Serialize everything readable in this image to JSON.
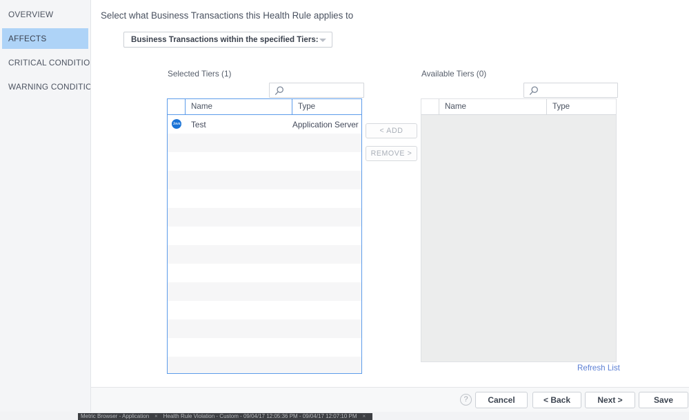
{
  "sidebar": {
    "items": [
      {
        "label": "OVERVIEW",
        "active": false
      },
      {
        "label": "AFFECTS",
        "active": true
      },
      {
        "label": "CRITICAL CONDITION",
        "active": false
      },
      {
        "label": "WARNING CONDITION",
        "active": false
      }
    ]
  },
  "main": {
    "heading": "Select what Business Transactions this Health Rule applies to",
    "scope_select": {
      "value": "Business Transactions within the specified Tiers:",
      "caret_icon": "chevron-down-icon"
    },
    "selected_panel": {
      "title": "Selected Tiers (1)",
      "search_placeholder": "",
      "search_value": "",
      "search_icon": "search-icon",
      "columns": [
        "",
        "Name",
        "Type"
      ],
      "rows": [
        {
          "icon": "java-icon",
          "icon_label": "Java",
          "name": "Test",
          "type": "Application Server"
        }
      ],
      "empty_row_count": 13
    },
    "available_panel": {
      "title": "Available Tiers (0)",
      "search_placeholder": "",
      "search_value": "",
      "search_icon": "search-icon",
      "columns": [
        "",
        "Name",
        "Type"
      ],
      "rows": [],
      "refresh_label": "Refresh List"
    },
    "transfer": {
      "add_label": "< ADD",
      "remove_label": "REMOVE >"
    }
  },
  "footer": {
    "help_label": "?",
    "help_icon": "question-circle-icon",
    "cancel_label": "Cancel",
    "back_label": "< Back",
    "next_label": "Next >",
    "save_label": "Save"
  },
  "taskbar": {
    "tabs": [
      "Metric Browser - Application",
      "Health Rule Violation - Custom - 09/04/17 12:05:36 PM - 09/04/17 12:07:10 PM"
    ],
    "close_glyph": "×"
  },
  "colors": {
    "accent_blue": "#5b9bea",
    "nav_active_bg": "#aed3f7",
    "link_blue": "#5b7fd4",
    "java_badge": "#1a73d6"
  }
}
